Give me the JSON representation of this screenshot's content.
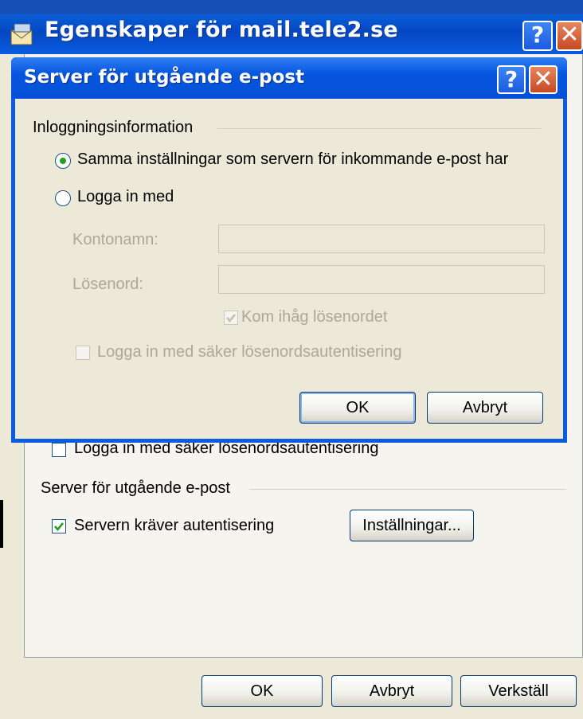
{
  "outer": {
    "title": "Egenskaper för mail.tele2.se",
    "help_label": "?",
    "close_label": "✕",
    "secure_auth_label": "Logga in med säker lösenordsautentisering",
    "outgoing_group_label": "Server för utgående e-post",
    "requires_auth_label": "Servern kräver autentisering",
    "requires_auth_checked": true,
    "settings_button": "Inställningar...",
    "ok_button": "OK",
    "cancel_button": "Avbryt",
    "apply_button": "Verkställ"
  },
  "dialog": {
    "title": "Server för utgående e-post",
    "help_label": "?",
    "close_label": "✕",
    "group_label": "Inloggningsinformation",
    "radio_same_label": "Samma inställningar som servern för inkommande e-post har",
    "radio_same_selected": true,
    "radio_login_label": "Logga in med",
    "account_label": "Kontonamn:",
    "account_value": "",
    "password_label": "Lösenord:",
    "password_value": "",
    "remember_label": "Kom ihåg lösenordet",
    "remember_checked": true,
    "spa_label": "Logga in med säker lösenordsautentisering",
    "spa_checked": false,
    "ok_button": "OK",
    "cancel_button": "Avbryt"
  }
}
